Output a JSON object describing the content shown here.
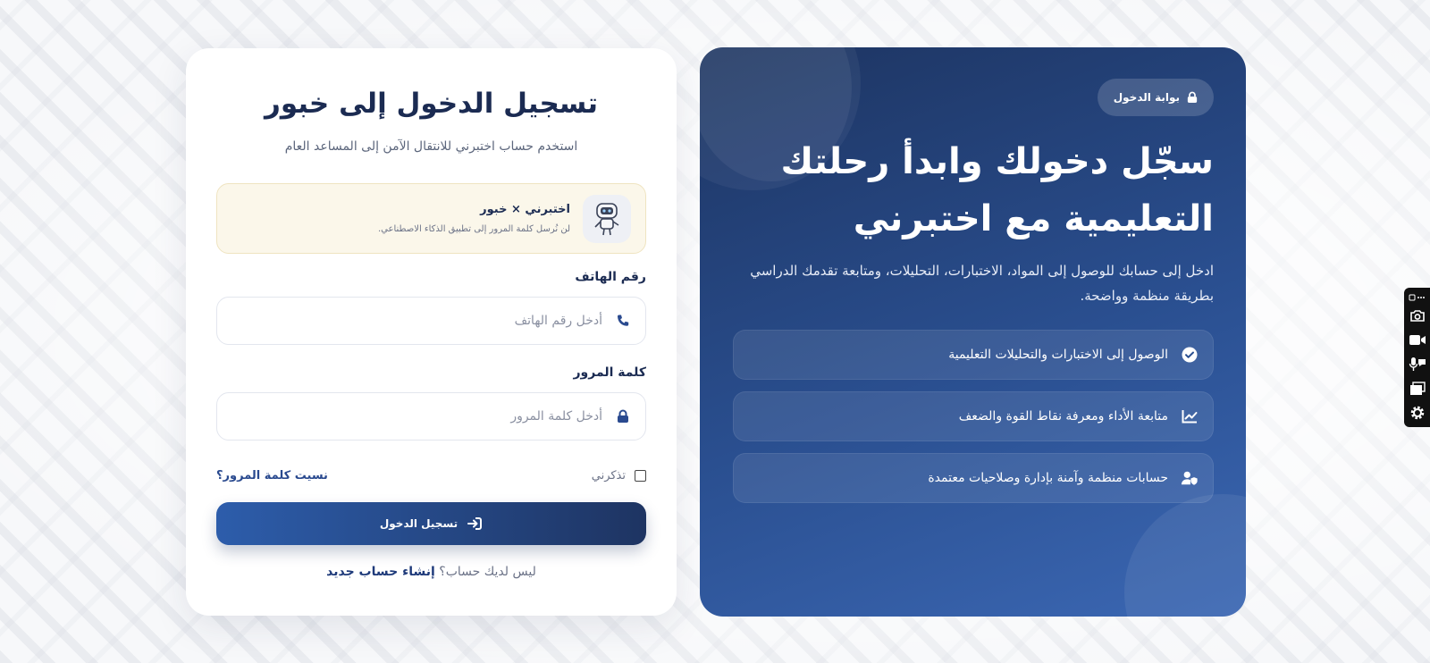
{
  "login": {
    "title": "تسجيل الدخول إلى خبور",
    "subtitle": "استخدم حساب اختبرني للانتقال الآمن إلى المساعد العام",
    "partner": {
      "title": "اختبرني × خبور",
      "note": "لن نُرسل كلمة المرور إلى تطبيق الذكاء الاصطناعي."
    },
    "phone": {
      "label": "رقم الهاتف",
      "placeholder": "أدخل رقم الهاتف",
      "icon": "phone-icon"
    },
    "password": {
      "label": "كلمة المرور",
      "placeholder": "أدخل كلمة المرور",
      "icon": "lock-icon"
    },
    "remember_label": "تذكرني",
    "forgot_label": "نسيت كلمة المرور؟",
    "submit_label": "تسجيل الدخول",
    "signup_prompt": "ليس لديك حساب؟",
    "signup_link": "إنشاء حساب جديد"
  },
  "promo": {
    "badge": "بوابة الدخول",
    "title_line1": "سجّل دخولك وابدأ رحلتك",
    "title_line2": "التعليمية مع اختبرني",
    "description": "ادخل إلى حسابك للوصول إلى المواد، الاختبارات، التحليلات، ومتابعة تقدمك الدراسي بطريقة منظمة وواضحة.",
    "features": [
      {
        "icon": "check-circle-icon",
        "label": "الوصول إلى الاختبارات والتحليلات التعليمية"
      },
      {
        "icon": "chart-line-icon",
        "label": "متابعة الأداء ومعرفة نقاط القوة والضعف"
      },
      {
        "icon": "user-shield-icon",
        "label": "حسابات منظمة وآمنة بإدارة وصلاحيات معتمدة"
      }
    ]
  },
  "toolbar": {
    "items": [
      "camera-icon",
      "video-icon",
      "microphone-icon",
      "window-icon",
      "gear-icon"
    ]
  },
  "colors": {
    "primary_dark": "#1e3462",
    "primary": "#2d5dab",
    "title": "#1b2b52",
    "partner_bg": "#fbf7ea"
  }
}
